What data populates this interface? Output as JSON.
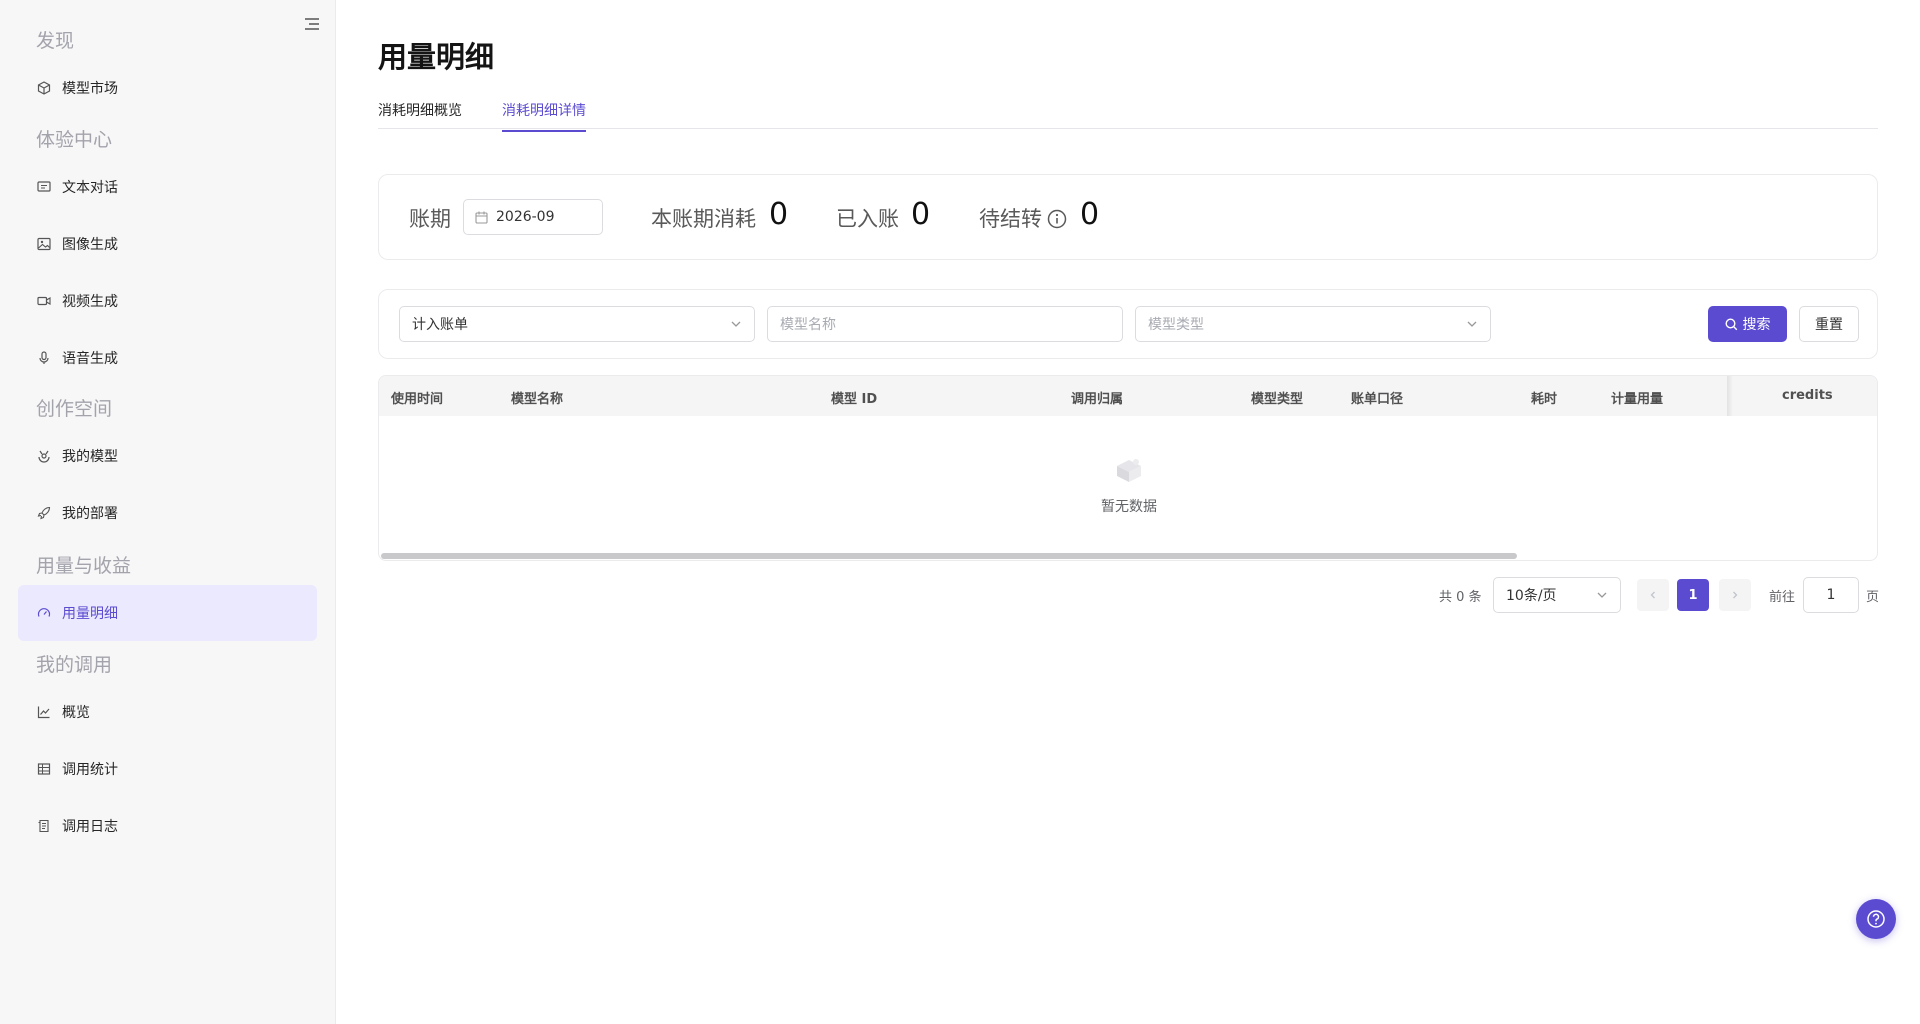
{
  "sidebar": {
    "groups": [
      {
        "title": "发现",
        "items": [
          {
            "label": "模型市场",
            "icon": "cube-icon"
          }
        ]
      },
      {
        "title": "体验中心",
        "items": [
          {
            "label": "文本对话",
            "icon": "chat-icon"
          },
          {
            "label": "图像生成",
            "icon": "image-icon"
          },
          {
            "label": "视频生成",
            "icon": "video-icon"
          },
          {
            "label": "语音生成",
            "icon": "microphone-icon"
          }
        ]
      },
      {
        "title": "创作空间",
        "items": [
          {
            "label": "我的模型",
            "icon": "model-icon"
          },
          {
            "label": "我的部署",
            "icon": "rocket-icon"
          }
        ]
      },
      {
        "title": "用量与收益",
        "items": [
          {
            "label": "用量明细",
            "icon": "gauge-icon",
            "active": true
          }
        ]
      },
      {
        "title": "我的调用",
        "items": [
          {
            "label": "概览",
            "icon": "line-chart-icon"
          },
          {
            "label": "调用统计",
            "icon": "table-icon"
          },
          {
            "label": "调用日志",
            "icon": "log-icon"
          }
        ]
      }
    ]
  },
  "page": {
    "title": "用量明细",
    "tabs": [
      {
        "label": "消耗明细概览",
        "active": false
      },
      {
        "label": "消耗明细详情",
        "active": true
      }
    ]
  },
  "summary": {
    "period_label": "账期",
    "period_value": "2026-09",
    "consumption_label": "本账期消耗",
    "consumption_value": "0",
    "posted_label": "已入账",
    "posted_value": "0",
    "pending_label": "待结转",
    "pending_value": "0"
  },
  "filters": {
    "bill_select_value": "计入账单",
    "model_name_placeholder": "模型名称",
    "model_type_placeholder": "模型类型",
    "search_label": "搜索",
    "reset_label": "重置"
  },
  "table": {
    "columns": [
      "使用时间",
      "模型名称",
      "模型 ID",
      "调用归属",
      "模型类型",
      "账单口径",
      "耗时",
      "计量用量",
      "credits"
    ],
    "rows": [],
    "empty_text": "暂无数据"
  },
  "pagination": {
    "total_text": "共 0 条",
    "page_size": "10条/页",
    "current_page": "1",
    "goto_label": "前往",
    "goto_value": "1",
    "page_unit": "页"
  },
  "colors": {
    "accent": "#5b4bd1",
    "active_bg": "#ebe9fd"
  }
}
